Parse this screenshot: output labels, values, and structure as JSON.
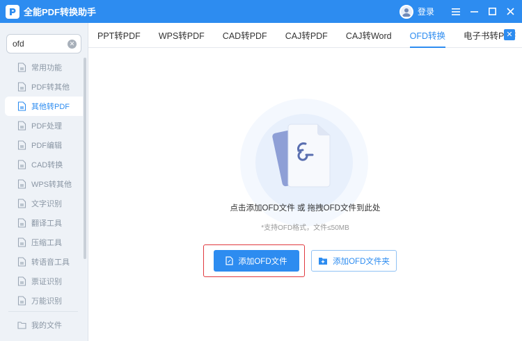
{
  "app": {
    "title": "全能PDF转换助手",
    "login_label": "登录"
  },
  "search": {
    "value": "ofd",
    "placeholder": ""
  },
  "sidebar": {
    "items": [
      {
        "label": "常用功能",
        "icon": "star-doc-icon",
        "active": false
      },
      {
        "label": "PDF转其他",
        "icon": "pdf-convert-icon",
        "active": false
      },
      {
        "label": "其他转PDF",
        "icon": "to-pdf-icon",
        "active": true
      },
      {
        "label": "PDF处理",
        "icon": "pdf-process-icon",
        "active": false
      },
      {
        "label": "PDF编辑",
        "icon": "pdf-edit-icon",
        "active": false
      },
      {
        "label": "CAD转换",
        "icon": "cad-icon",
        "active": false
      },
      {
        "label": "WPS转其他",
        "icon": "wps-icon",
        "active": false
      },
      {
        "label": "文字识别",
        "icon": "ocr-icon",
        "active": false
      },
      {
        "label": "翻译工具",
        "icon": "translate-icon",
        "active": false
      },
      {
        "label": "压缩工具",
        "icon": "compress-icon",
        "active": false
      },
      {
        "label": "转语音工具",
        "icon": "voice-icon",
        "active": false
      },
      {
        "label": "票证识别",
        "icon": "ticket-icon",
        "active": false
      },
      {
        "label": "万能识别",
        "icon": "scan-icon",
        "active": false
      }
    ],
    "bottom": {
      "label": "我的文件",
      "icon": "folder-icon"
    }
  },
  "tabs": [
    {
      "label": "PPT转PDF",
      "active": false
    },
    {
      "label": "WPS转PDF",
      "active": false
    },
    {
      "label": "CAD转PDF",
      "active": false
    },
    {
      "label": "CAJ转PDF",
      "active": false
    },
    {
      "label": "CAJ转Word",
      "active": false
    },
    {
      "label": "OFD转换",
      "active": true
    },
    {
      "label": "电子书转PDF",
      "active": false
    }
  ],
  "main": {
    "drop_text": "点击添加OFD文件 或 拖拽OFD文件到此处",
    "support_text": "*支持OFD格式，文件≤50MB",
    "add_file_label": "添加OFD文件",
    "add_folder_label": "添加OFD文件夹"
  },
  "colors": {
    "accent": "#2d8cf0",
    "highlight": "#e0383e",
    "sidebar_bg": "#eef2f7"
  }
}
